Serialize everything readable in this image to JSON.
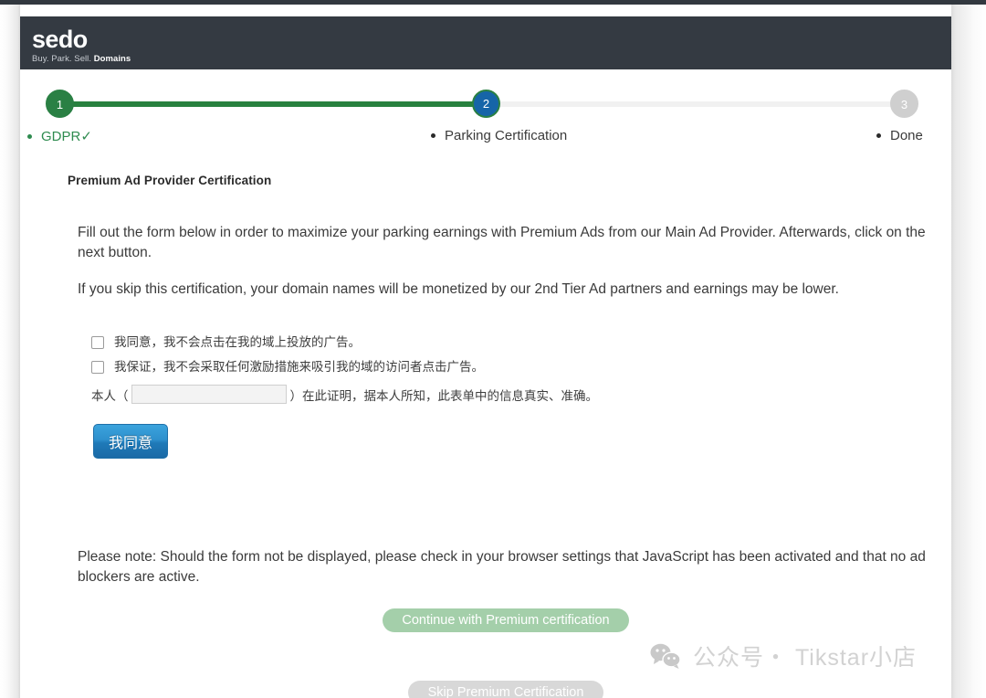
{
  "brand": {
    "logo_word": "sedo",
    "logo_tagline_plain": "Buy. Park. Sell. ",
    "logo_tagline_bold": "Domains",
    "header_bg": "#343a42"
  },
  "stepper": {
    "steps": [
      {
        "number": "1",
        "label": "GDPR✓",
        "state": "done",
        "color": "#2a8044"
      },
      {
        "number": "2",
        "label": "Parking Certification",
        "state": "current",
        "color": "#1665a8"
      },
      {
        "number": "3",
        "label": "Done",
        "state": "todo",
        "color": "#cfcfcf"
      }
    ],
    "track_done_color": "#28813f",
    "track_todo_color": "#f1f1f1"
  },
  "content": {
    "section_title": "Premium Ad Provider Certification",
    "paragraph_1": "Fill out the form below in order to maximize your parking earnings with Premium Ads from our Main Ad Provider. Afterwards, click on the next button.",
    "paragraph_2": "If you skip this certification, your domain names will be monetized by our 2nd Tier Ad partners and earnings may be lower.",
    "note": "Please note: Should the form not be displayed, please check in your browser settings that JavaScript has been activated and that no ad blockers are active."
  },
  "form": {
    "checkbox_1": {
      "label": "我同意，我不会点击在我的域上投放的广告。",
      "checked": false
    },
    "checkbox_2": {
      "label": "我保证，我不会采取任何激励措施来吸引我的域的访问者点击广告。",
      "checked": false
    },
    "attestation": {
      "prefix": "本人（",
      "suffix": "）在此证明，据本人所知，此表单中的信息真实、准确。",
      "input_value": "",
      "input_placeholder": ""
    },
    "agree_button": "我同意"
  },
  "actions": {
    "continue_label": "Continue with Premium certification",
    "continue_color": "#a4cfaa",
    "skip_label": "Skip Premium Certification",
    "skip_color": "#d8d8d8"
  },
  "watermark": {
    "text": "公众号・ Tikstar小店",
    "icon": "wechat-icon",
    "color": "#d2d2d2"
  }
}
